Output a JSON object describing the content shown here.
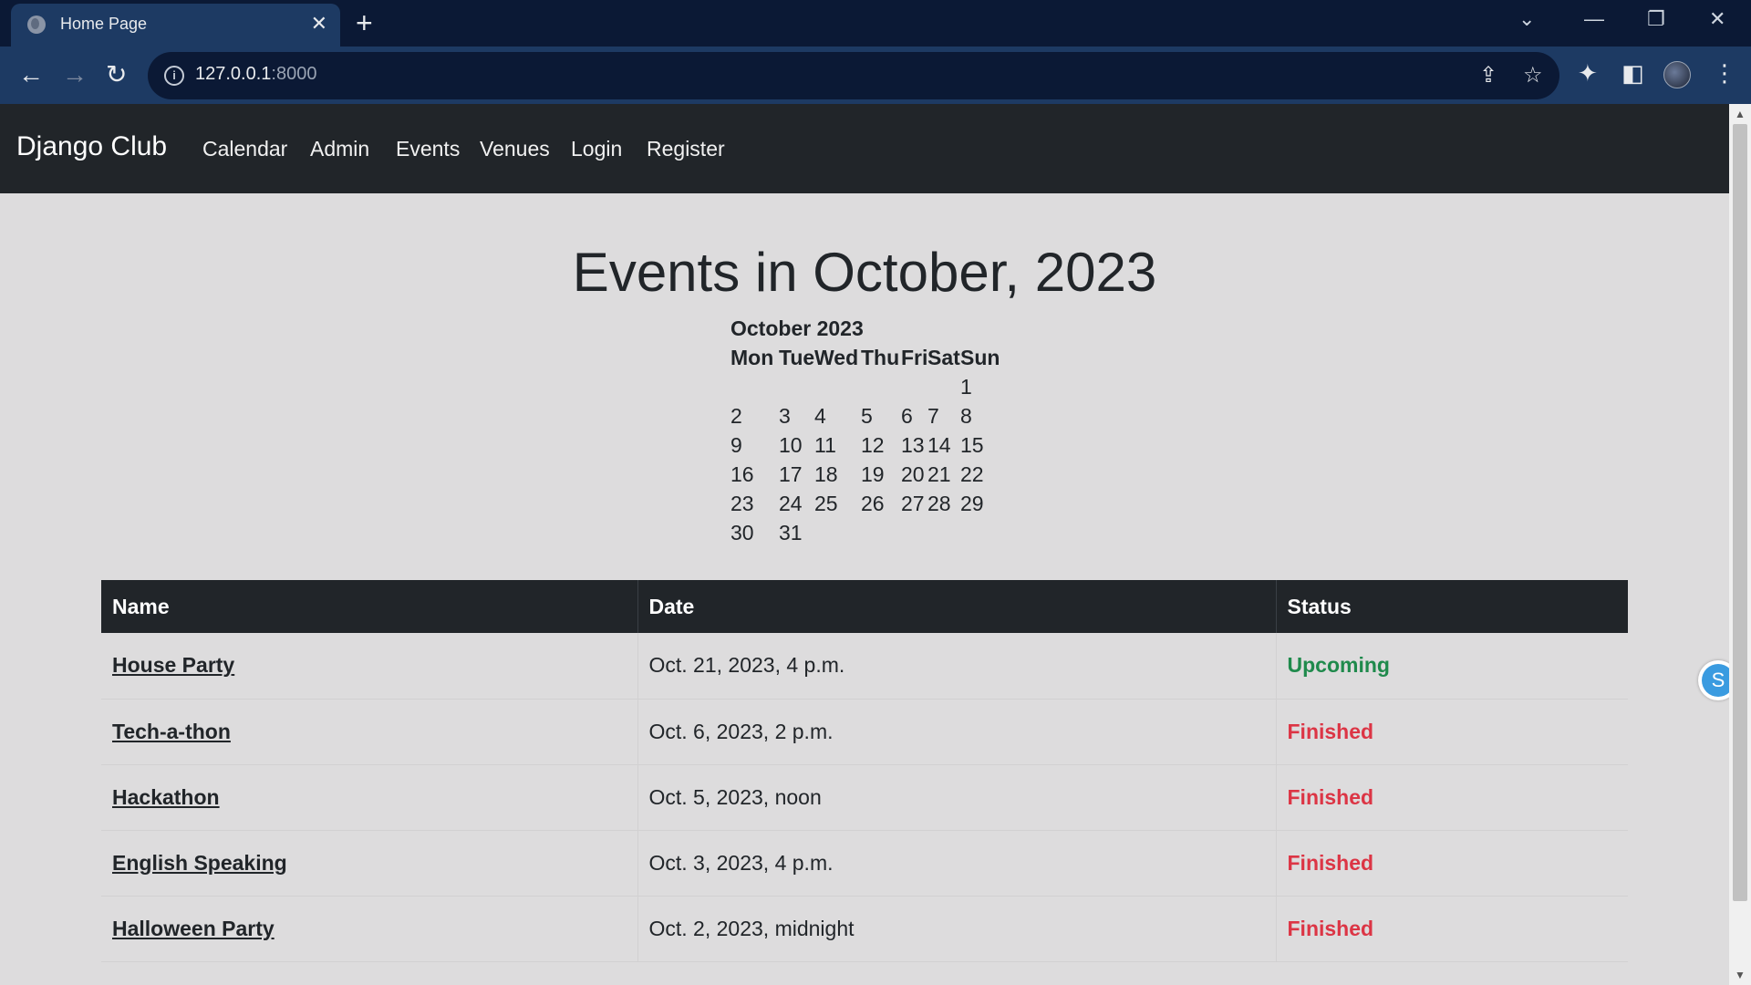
{
  "browser": {
    "tab_title": "Home Page",
    "url_host": "127.0.0.1",
    "url_port": ":8000"
  },
  "site": {
    "brand": "Django Club",
    "nav": [
      "Calendar",
      "Admin",
      "Events",
      "Venues",
      "Login",
      "Register"
    ]
  },
  "page": {
    "heading": "Events in October, 2023"
  },
  "calendar": {
    "month_title": "October 2023",
    "weekdays": [
      "Mon",
      "Tue",
      "Wed",
      "Thu",
      "Fri",
      "Sat",
      "Sun"
    ],
    "weeks": [
      [
        "",
        "",
        "",
        "",
        "",
        "",
        "1"
      ],
      [
        "2",
        "3",
        "4",
        "5",
        "6",
        "7",
        "8"
      ],
      [
        "9",
        "10",
        "11",
        "12",
        "13",
        "14",
        "15"
      ],
      [
        "16",
        "17",
        "18",
        "19",
        "20",
        "21",
        "22"
      ],
      [
        "23",
        "24",
        "25",
        "26",
        "27",
        "28",
        "29"
      ],
      [
        "30",
        "31",
        "",
        "",
        "",
        "",
        ""
      ]
    ]
  },
  "events_table": {
    "headers": [
      "Name",
      "Date",
      "Status"
    ],
    "rows": [
      {
        "name": "House Party",
        "date": "Oct. 21, 2023, 4 p.m.",
        "status": "Upcoming",
        "status_color": "#1f8a4c"
      },
      {
        "name": "Tech-a-thon",
        "date": "Oct. 6, 2023, 2 p.m.",
        "status": "Finished",
        "status_color": "#dc3545"
      },
      {
        "name": "Hackathon",
        "date": "Oct. 5, 2023, noon",
        "status": "Finished",
        "status_color": "#dc3545"
      },
      {
        "name": "English Speaking",
        "date": "Oct. 3, 2023, 4 p.m.",
        "status": "Finished",
        "status_color": "#dc3545"
      },
      {
        "name": "Halloween Party",
        "date": "Oct. 2, 2023, midnight",
        "status": "Finished",
        "status_color": "#dc3545"
      }
    ]
  },
  "icons": {
    "tab_favicon": "globe-icon",
    "floating": "s-icon",
    "floating_letter": "S"
  }
}
